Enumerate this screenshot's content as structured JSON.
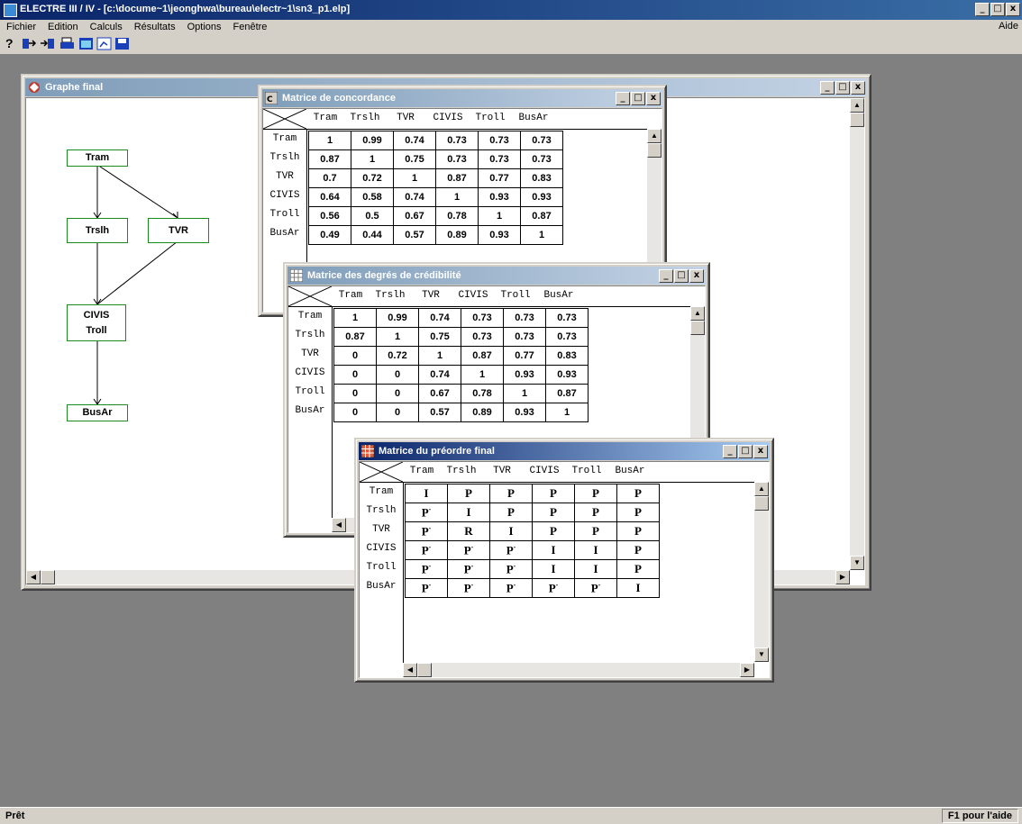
{
  "app": {
    "title": "ELECTRE III / IV - [c:\\docume~1\\jeonghwa\\bureau\\electr~1\\sn3_p1.elp]",
    "window_buttons": [
      "_",
      "□",
      "x"
    ]
  },
  "menu": {
    "items": [
      "Fichier",
      "Edition",
      "Calculs",
      "Résultats",
      "Options",
      "Fenêtre"
    ],
    "help": "Aide"
  },
  "toolbar": {
    "help_glyph": "?",
    "icons": [
      "help-icon",
      "export-left-icon",
      "export-right-icon",
      "print-icon",
      "table-icon",
      "chart-icon",
      "save-icon"
    ]
  },
  "status": {
    "left": "Prêt",
    "right": "F1 pour l'aide"
  },
  "graph_window": {
    "title": "Graphe final",
    "nodes": {
      "tram": "Tram",
      "trslh": "Trslh",
      "tvr": "TVR",
      "civis": "CIVIS",
      "troll": "Troll",
      "busar": "BusAr"
    }
  },
  "alternatives": [
    "Tram",
    "Trslh",
    "TVR",
    "CIVIS",
    "Troll",
    "BusAr"
  ],
  "concordance": {
    "title": "Matrice de concordance",
    "rows": [
      [
        "1",
        "0.99",
        "0.74",
        "0.73",
        "0.73",
        "0.73"
      ],
      [
        "0.87",
        "1",
        "0.75",
        "0.73",
        "0.73",
        "0.73"
      ],
      [
        "0.7",
        "0.72",
        "1",
        "0.87",
        "0.77",
        "0.83"
      ],
      [
        "0.64",
        "0.58",
        "0.74",
        "1",
        "0.93",
        "0.93"
      ],
      [
        "0.56",
        "0.5",
        "0.67",
        "0.78",
        "1",
        "0.87"
      ],
      [
        "0.49",
        "0.44",
        "0.57",
        "0.89",
        "0.93",
        "1"
      ]
    ]
  },
  "credibility": {
    "title": "Matrice des degrés de crédibilité",
    "rows": [
      [
        "1",
        "0.99",
        "0.74",
        "0.73",
        "0.73",
        "0.73"
      ],
      [
        "0.87",
        "1",
        "0.75",
        "0.73",
        "0.73",
        "0.73"
      ],
      [
        "0",
        "0.72",
        "1",
        "0.87",
        "0.77",
        "0.83"
      ],
      [
        "0",
        "0",
        "0.74",
        "1",
        "0.93",
        "0.93"
      ],
      [
        "0",
        "0",
        "0.67",
        "0.78",
        "1",
        "0.87"
      ],
      [
        "0",
        "0",
        "0.57",
        "0.89",
        "0.93",
        "1"
      ]
    ]
  },
  "preorder": {
    "title": "Matrice du préordre final",
    "rows": [
      [
        "I",
        "P",
        "P",
        "P",
        "P",
        "P"
      ],
      [
        "P-",
        "I",
        "P",
        "P",
        "P",
        "P"
      ],
      [
        "P-",
        "R",
        "I",
        "P",
        "P",
        "P"
      ],
      [
        "P-",
        "P-",
        "P-",
        "I",
        "I",
        "P"
      ],
      [
        "P-",
        "P-",
        "P-",
        "I",
        "I",
        "P"
      ],
      [
        "P-",
        "P-",
        "P-",
        "P-",
        "P-",
        "I"
      ]
    ]
  },
  "colors": {
    "title_active": "#0a246a",
    "title_inactive": "#7f9db9",
    "node_border": "#1b8a1b",
    "workspace": "#808080"
  }
}
